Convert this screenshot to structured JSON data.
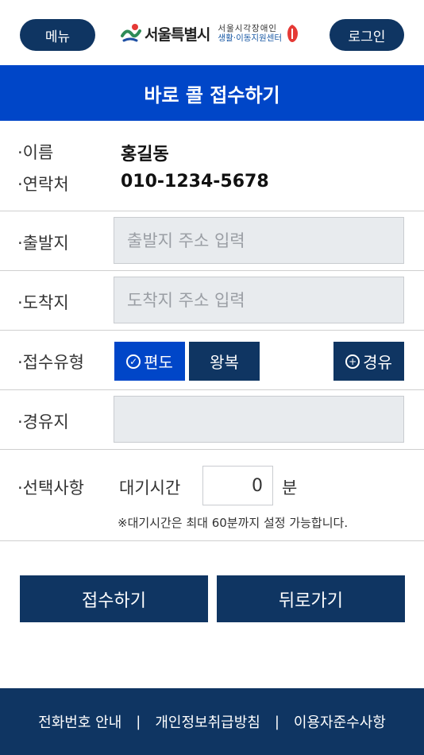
{
  "header": {
    "menu_label": "메뉴",
    "login_label": "로그인",
    "logo_text": "서울특별시",
    "logo_sub_line1": "서울시각장애인",
    "logo_sub_line2": "생활·이동지원센터"
  },
  "title": "바로 콜 접수하기",
  "info": {
    "name_label": "·이름",
    "name_value": "홍길동",
    "phone_label": "·연락처",
    "phone_value": "010-1234-5678"
  },
  "departure": {
    "label": "·출발지",
    "placeholder": "출발지 주소 입력"
  },
  "arrival": {
    "label": "·도착지",
    "placeholder": "도착지 주소 입력"
  },
  "trip_type": {
    "label": "·접수유형",
    "oneway": "편도",
    "round": "왕복",
    "via": "경유",
    "selected": "편도"
  },
  "waypoint": {
    "label": "·경유지",
    "placeholder": ""
  },
  "options": {
    "label": "·선택사항",
    "wait_label": "대기시간",
    "wait_value": "0",
    "wait_unit": "분",
    "note": "※대기시간은 최대 60분까지 설정 가능합니다."
  },
  "actions": {
    "submit": "접수하기",
    "back": "뒤로가기"
  },
  "footer": {
    "link1": "전화번호 안내",
    "link2": "개인정보취급방침",
    "link3": "이용자준수사항",
    "separator": "|"
  },
  "colors": {
    "primary_blue": "#0046c8",
    "navy": "#0f3562",
    "input_bg": "#e8ebee"
  }
}
